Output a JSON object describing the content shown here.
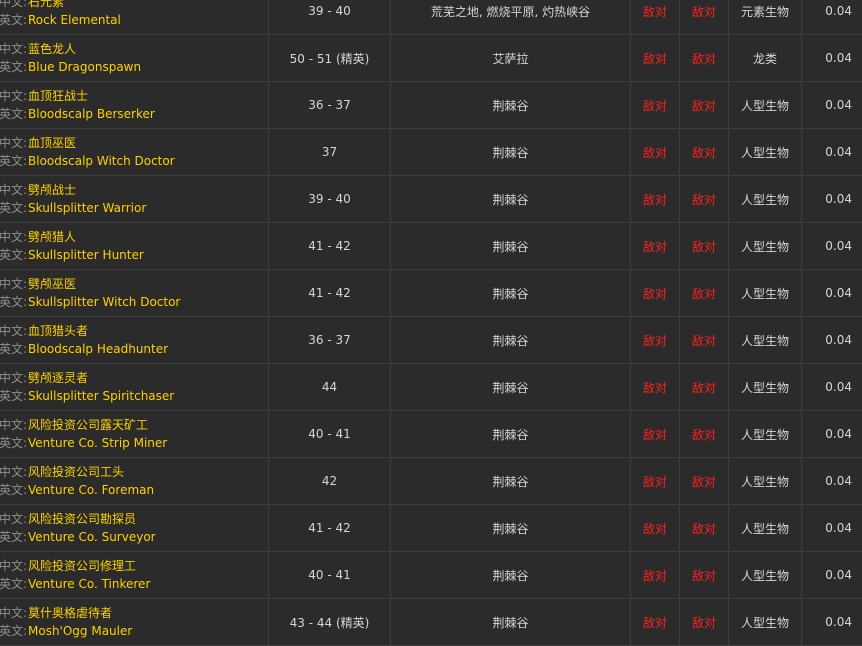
{
  "colors": {
    "background": "#2b2b2b",
    "border": "#3e3e3e",
    "name_gold": "#ffd100",
    "hostile_red": "#ff2020",
    "tag_gray": "#8f8f8f",
    "text_light": "#d6d6d6"
  },
  "labels": {
    "cn_tag": "中文:",
    "en_tag": "英文:"
  },
  "rows": [
    {
      "cn": "石元素",
      "en": "Rock Elemental",
      "level": "39 - 40",
      "zone": "荒芜之地, 燃烧平原, 灼热峡谷",
      "rel1": "敌对",
      "rel2": "敌对",
      "type": "元素生物",
      "value": "0.04"
    },
    {
      "cn": "蓝色龙人",
      "en": "Blue Dragonspawn",
      "level": "50 - 51 (精英)",
      "zone": "艾萨拉",
      "rel1": "敌对",
      "rel2": "敌对",
      "type": "龙类",
      "value": "0.04"
    },
    {
      "cn": "血顶狂战士",
      "en": "Bloodscalp Berserker",
      "level": "36 - 37",
      "zone": "荆棘谷",
      "rel1": "敌对",
      "rel2": "敌对",
      "type": "人型生物",
      "value": "0.04"
    },
    {
      "cn": "血顶巫医",
      "en": "Bloodscalp Witch Doctor",
      "level": "37",
      "zone": "荆棘谷",
      "rel1": "敌对",
      "rel2": "敌对",
      "type": "人型生物",
      "value": "0.04"
    },
    {
      "cn": "劈颅战士",
      "en": "Skullsplitter Warrior",
      "level": "39 - 40",
      "zone": "荆棘谷",
      "rel1": "敌对",
      "rel2": "敌对",
      "type": "人型生物",
      "value": "0.04"
    },
    {
      "cn": "劈颅猎人",
      "en": "Skullsplitter Hunter",
      "level": "41 - 42",
      "zone": "荆棘谷",
      "rel1": "敌对",
      "rel2": "敌对",
      "type": "人型生物",
      "value": "0.04"
    },
    {
      "cn": "劈颅巫医",
      "en": "Skullsplitter Witch Doctor",
      "level": "41 - 42",
      "zone": "荆棘谷",
      "rel1": "敌对",
      "rel2": "敌对",
      "type": "人型生物",
      "value": "0.04"
    },
    {
      "cn": "血顶猎头者",
      "en": "Bloodscalp Headhunter",
      "level": "36 - 37",
      "zone": "荆棘谷",
      "rel1": "敌对",
      "rel2": "敌对",
      "type": "人型生物",
      "value": "0.04"
    },
    {
      "cn": "劈颅逐灵者",
      "en": "Skullsplitter Spiritchaser",
      "level": "44",
      "zone": "荆棘谷",
      "rel1": "敌对",
      "rel2": "敌对",
      "type": "人型生物",
      "value": "0.04"
    },
    {
      "cn": "风险投资公司露天矿工",
      "en": "Venture Co. Strip Miner",
      "level": "40 - 41",
      "zone": "荆棘谷",
      "rel1": "敌对",
      "rel2": "敌对",
      "type": "人型生物",
      "value": "0.04"
    },
    {
      "cn": "风险投资公司工头",
      "en": "Venture Co. Foreman",
      "level": "42",
      "zone": "荆棘谷",
      "rel1": "敌对",
      "rel2": "敌对",
      "type": "人型生物",
      "value": "0.04"
    },
    {
      "cn": "风险投资公司勘探员",
      "en": "Venture Co. Surveyor",
      "level": "41 - 42",
      "zone": "荆棘谷",
      "rel1": "敌对",
      "rel2": "敌对",
      "type": "人型生物",
      "value": "0.04"
    },
    {
      "cn": "风险投资公司修理工",
      "en": "Venture Co. Tinkerer",
      "level": "40 - 41",
      "zone": "荆棘谷",
      "rel1": "敌对",
      "rel2": "敌对",
      "type": "人型生物",
      "value": "0.04"
    },
    {
      "cn": "莫什奥格虐待者",
      "en": "Mosh'Ogg Mauler",
      "level": "43 - 44 (精英)",
      "zone": "荆棘谷",
      "rel1": "敌对",
      "rel2": "敌对",
      "type": "人型生物",
      "value": "0.04"
    }
  ]
}
